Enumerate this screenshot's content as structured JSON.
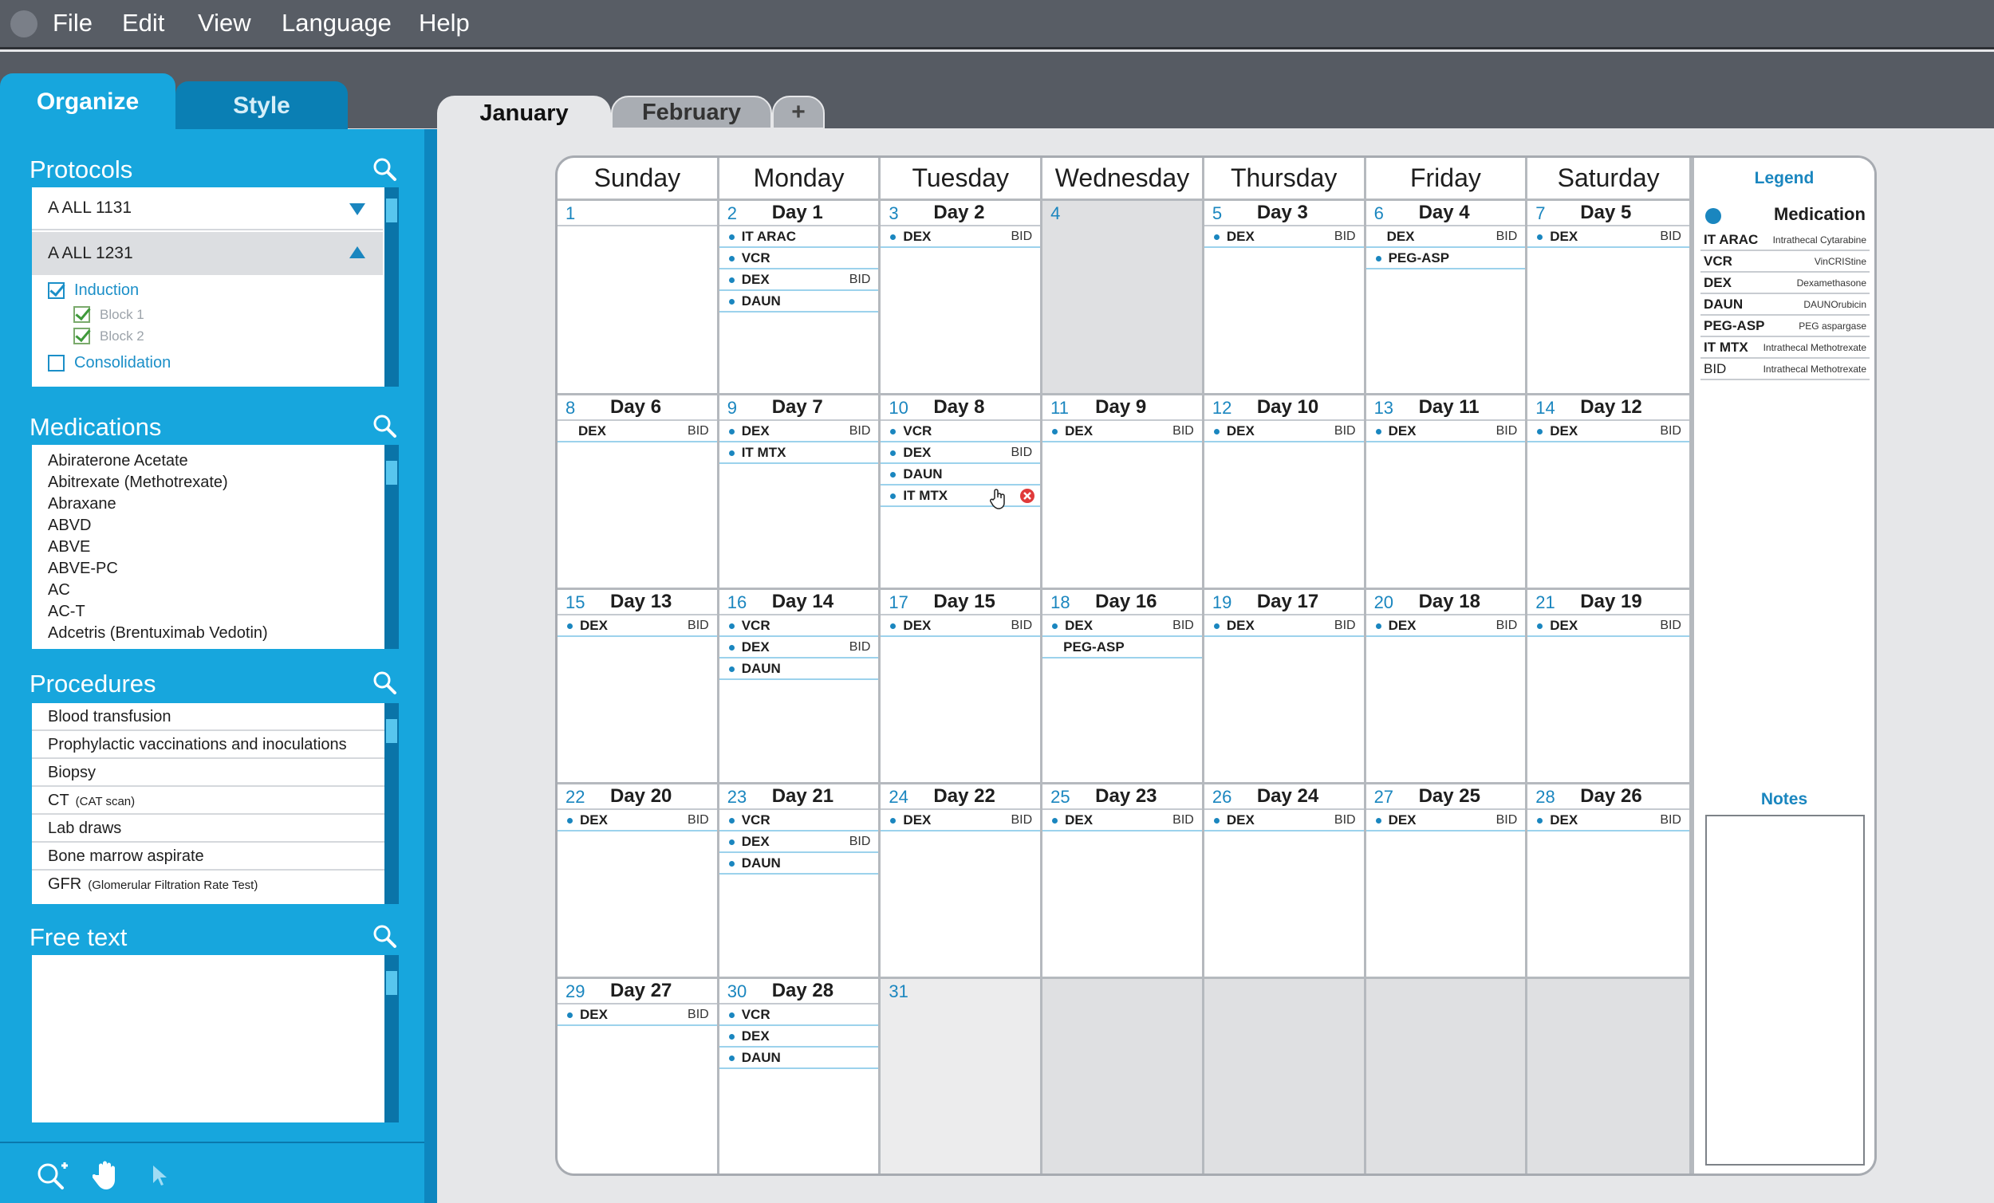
{
  "menu": [
    "File",
    "Edit",
    "View",
    "Language",
    "Help"
  ],
  "side_tabs": {
    "organize": "Organize",
    "style": "Style"
  },
  "sections": {
    "protocols": "Protocols",
    "medications": "Medications",
    "procedures": "Procedures",
    "free_text": "Free text"
  },
  "protocols": {
    "items": [
      "A ALL 1131",
      "A ALL 1231"
    ],
    "tree": {
      "induction": "Induction",
      "block1": "Block 1",
      "block2": "Block 2",
      "consolidation": "Consolidation"
    }
  },
  "medications": [
    "Abiraterone Acetate",
    "Abitrexate (Methotrexate)",
    "Abraxane",
    "ABVD",
    "ABVE",
    "ABVE-PC",
    "AC",
    "AC-T",
    "Adcetris (Brentuximab Vedotin)"
  ],
  "procedures": [
    {
      "name": "Blood transfusion",
      "note": ""
    },
    {
      "name": "Prophylactic vaccinations and inoculations",
      "note": ""
    },
    {
      "name": "Biopsy",
      "note": ""
    },
    {
      "name": "CT",
      "note": "(CAT scan)"
    },
    {
      "name": "Lab draws",
      "note": ""
    },
    {
      "name": "Bone marrow aspirate",
      "note": ""
    },
    {
      "name": "GFR",
      "note": "(Glomerular Filtration Rate Test)"
    }
  ],
  "month_tabs": {
    "active": "January",
    "other": "February",
    "add": "+"
  },
  "weekdays": [
    "Sunday",
    "Monday",
    "Tuesday",
    "Wednesday",
    "Thursday",
    "Friday",
    "Saturday"
  ],
  "calendar": [
    {
      "num": "1",
      "day": "",
      "entries": []
    },
    {
      "num": "2",
      "day": "Day 1",
      "entries": [
        {
          "n": "IT ARAC",
          "b": ""
        },
        {
          "n": "VCR",
          "b": ""
        },
        {
          "n": "DEX",
          "b": "BID"
        },
        {
          "n": "DAUN",
          "b": ""
        }
      ]
    },
    {
      "num": "3",
      "day": "Day 2",
      "entries": [
        {
          "n": "DEX",
          "b": "BID"
        }
      ]
    },
    {
      "num": "4",
      "day": "",
      "entries": [],
      "shade": "gray"
    },
    {
      "num": "5",
      "day": "Day 3",
      "entries": [
        {
          "n": "DEX",
          "b": "BID"
        }
      ]
    },
    {
      "num": "6",
      "day": "Day 4",
      "entries": [
        {
          "n": "DEX",
          "b": "BID",
          "nodot": true
        },
        {
          "n": "PEG-ASP",
          "b": ""
        }
      ]
    },
    {
      "num": "7",
      "day": "Day 5",
      "entries": [
        {
          "n": "DEX",
          "b": "BID"
        }
      ]
    },
    {
      "num": "8",
      "day": "Day 6",
      "entries": [
        {
          "n": "DEX",
          "b": "BID",
          "nodot": true
        }
      ]
    },
    {
      "num": "9",
      "day": "Day 7",
      "entries": [
        {
          "n": "DEX",
          "b": "BID"
        },
        {
          "n": "IT MTX",
          "b": ""
        }
      ]
    },
    {
      "num": "10",
      "day": "Day 8",
      "entries": [
        {
          "n": "VCR",
          "b": ""
        },
        {
          "n": "DEX",
          "b": "BID"
        },
        {
          "n": "DAUN",
          "b": ""
        },
        {
          "n": "IT MTX",
          "b": "",
          "remove": true
        }
      ]
    },
    {
      "num": "11",
      "day": "Day 9",
      "entries": [
        {
          "n": "DEX",
          "b": "BID"
        }
      ]
    },
    {
      "num": "12",
      "day": "Day 10",
      "entries": [
        {
          "n": "DEX",
          "b": "BID"
        }
      ]
    },
    {
      "num": "13",
      "day": "Day 11",
      "entries": [
        {
          "n": "DEX",
          "b": "BID"
        }
      ]
    },
    {
      "num": "14",
      "day": "Day 12",
      "entries": [
        {
          "n": "DEX",
          "b": "BID"
        }
      ]
    },
    {
      "num": "15",
      "day": "Day 13",
      "entries": [
        {
          "n": "DEX",
          "b": "BID"
        }
      ]
    },
    {
      "num": "16",
      "day": "Day 14",
      "entries": [
        {
          "n": "VCR",
          "b": ""
        },
        {
          "n": "DEX",
          "b": "BID"
        },
        {
          "n": "DAUN",
          "b": ""
        }
      ]
    },
    {
      "num": "17",
      "day": "Day 15",
      "entries": [
        {
          "n": "DEX",
          "b": "BID"
        }
      ]
    },
    {
      "num": "18",
      "day": "Day 16",
      "entries": [
        {
          "n": "DEX",
          "b": "BID"
        },
        {
          "n": "PEG-ASP",
          "b": "",
          "nodot": true
        }
      ]
    },
    {
      "num": "19",
      "day": "Day 17",
      "entries": [
        {
          "n": "DEX",
          "b": "BID"
        }
      ]
    },
    {
      "num": "20",
      "day": "Day 18",
      "entries": [
        {
          "n": "DEX",
          "b": "BID"
        }
      ]
    },
    {
      "num": "21",
      "day": "Day 19",
      "entries": [
        {
          "n": "DEX",
          "b": "BID"
        }
      ]
    },
    {
      "num": "22",
      "day": "Day 20",
      "entries": [
        {
          "n": "DEX",
          "b": "BID"
        }
      ]
    },
    {
      "num": "23",
      "day": "Day 21",
      "entries": [
        {
          "n": "VCR",
          "b": ""
        },
        {
          "n": "DEX",
          "b": "BID"
        },
        {
          "n": "DAUN",
          "b": ""
        }
      ]
    },
    {
      "num": "24",
      "day": "Day 22",
      "entries": [
        {
          "n": "DEX",
          "b": "BID"
        }
      ]
    },
    {
      "num": "25",
      "day": "Day 23",
      "entries": [
        {
          "n": "DEX",
          "b": "BID"
        }
      ]
    },
    {
      "num": "26",
      "day": "Day 24",
      "entries": [
        {
          "n": "DEX",
          "b": "BID"
        }
      ]
    },
    {
      "num": "27",
      "day": "Day 25",
      "entries": [
        {
          "n": "DEX",
          "b": "BID"
        }
      ]
    },
    {
      "num": "28",
      "day": "Day 26",
      "entries": [
        {
          "n": "DEX",
          "b": "BID"
        }
      ]
    },
    {
      "num": "29",
      "day": "Day 27",
      "entries": [
        {
          "n": "DEX",
          "b": "BID"
        }
      ]
    },
    {
      "num": "30",
      "day": "Day 28",
      "entries": [
        {
          "n": "VCR",
          "b": ""
        },
        {
          "n": "DEX",
          "b": ""
        },
        {
          "n": "DAUN",
          "b": ""
        }
      ]
    },
    {
      "num": "31",
      "day": "",
      "entries": [],
      "shade": "lgray"
    },
    {
      "num": "",
      "day": "",
      "entries": [],
      "shade": "gray"
    },
    {
      "num": "",
      "day": "",
      "entries": [],
      "shade": "gray"
    },
    {
      "num": "",
      "day": "",
      "entries": [],
      "shade": "gray"
    },
    {
      "num": "",
      "day": "",
      "entries": [],
      "shade": "gray"
    }
  ],
  "legend": {
    "title": "Legend",
    "header": "Medication",
    "items": [
      {
        "code": "IT ARAC",
        "desc": "Intrathecal Cytarabine"
      },
      {
        "code": "VCR",
        "desc": "VinCRIStine"
      },
      {
        "code": "DEX",
        "desc": "Dexamethasone"
      },
      {
        "code": "DAUN",
        "desc": "DAUNOrubicin"
      },
      {
        "code": "PEG-ASP",
        "desc": "PEG aspargase"
      },
      {
        "code": "IT MTX",
        "desc": "Intrathecal Methotrexate"
      },
      {
        "code": "BID",
        "desc": "Intrathecal Methotrexate"
      }
    ],
    "notes_title": "Notes"
  },
  "colors": {
    "accent": "#17a6dd",
    "dark_accent": "#0a7fb4",
    "menubar": "#585d65",
    "day_number": "#1a86bf",
    "remove": "#e03a3a"
  },
  "icons": [
    "search-icon",
    "chevron-down-icon",
    "chevron-up-icon",
    "zoom-in-icon",
    "hand-icon",
    "pointer-icon",
    "remove-icon",
    "hand-cursor-icon"
  ]
}
